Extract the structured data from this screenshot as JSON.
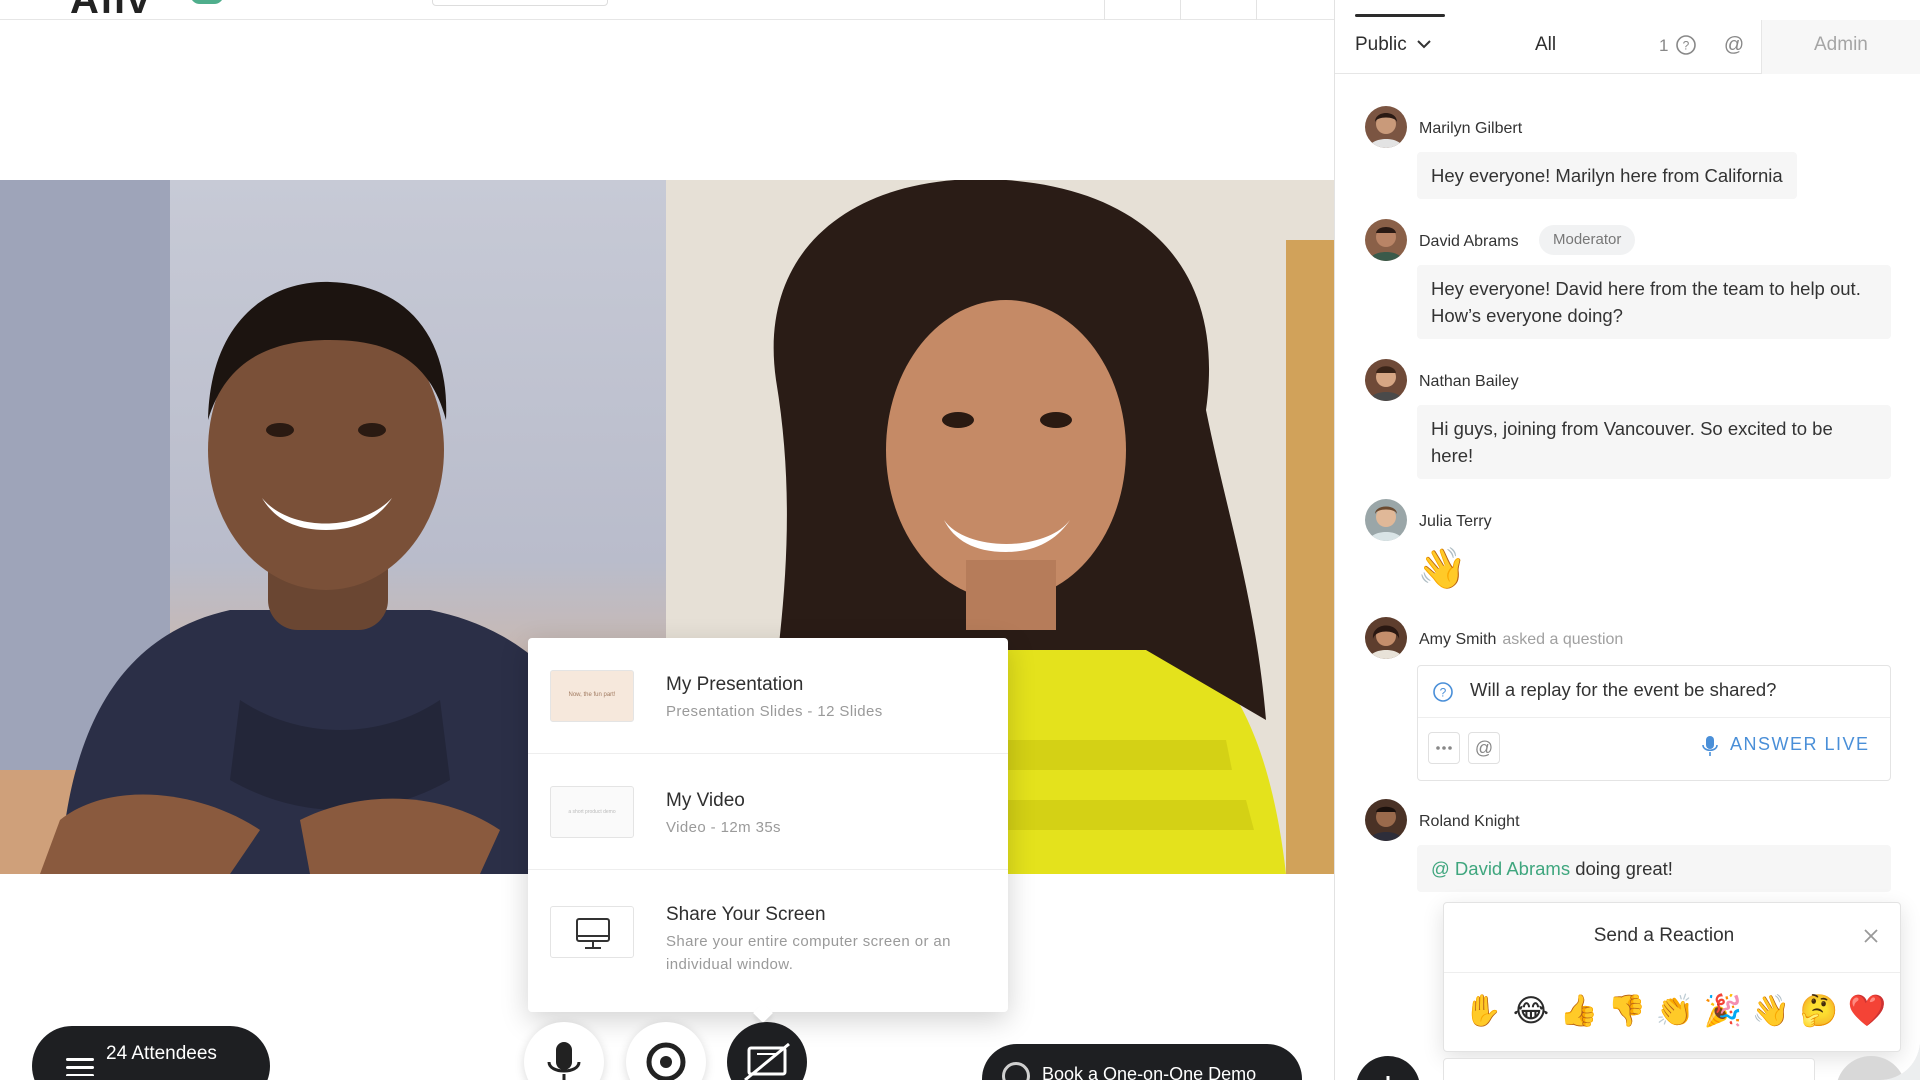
{
  "header": {
    "logo_text": "Aliv"
  },
  "share_menu": {
    "items": [
      {
        "title": "My Presentation",
        "subtitle": "Presentation Slides - 12 Slides",
        "thumb_text": "Now, the fun part!"
      },
      {
        "title": "My Video",
        "subtitle": "Video - 12m 35s",
        "thumb_text": "a short product demo"
      },
      {
        "title": "Share Your Screen",
        "subtitle": "Share your entire computer screen or an individual window.",
        "icon": "monitor-icon"
      }
    ]
  },
  "controls": {
    "attendees_label": "24 Attendees",
    "demo_label": "Book a One-on-One Demo",
    "mic_icon": "microphone-icon",
    "camera_icon": "camera-icon",
    "share_icon": "share-screen-icon"
  },
  "chat": {
    "tabs": {
      "public_label": "Public",
      "all_label": "All",
      "questions_count": "1",
      "admin_label": "Admin"
    },
    "messages": [
      {
        "author": "Marilyn Gilbert",
        "text": "Hey everyone! Marilyn here from California"
      },
      {
        "author": "David Abrams",
        "role": "Moderator",
        "text": "Hey everyone! David here from the team to help out. How’s everyone doing?"
      },
      {
        "author": "Nathan Bailey",
        "text": "Hi guys, joining from Vancouver. So excited to be here!"
      },
      {
        "author": "Julia Terry",
        "emoji": "👋"
      },
      {
        "author": "Amy Smith",
        "note": "asked a question",
        "question": "Will a replay for the event be shared?",
        "answer_label": "ANSWER LIVE"
      },
      {
        "author": "Roland Knight",
        "mention": "@ David Abrams",
        "text": "doing great!"
      }
    ]
  },
  "reactions": {
    "title": "Send a Reaction",
    "emojis": [
      "✋",
      "😂",
      "👍",
      "👎",
      "👏",
      "🎉",
      "👋",
      "🤔",
      "❤️"
    ]
  },
  "colors": {
    "accent_green": "#3fa67e",
    "answer_blue": "#4a8fd8",
    "dark_control": "#1e1f22"
  }
}
